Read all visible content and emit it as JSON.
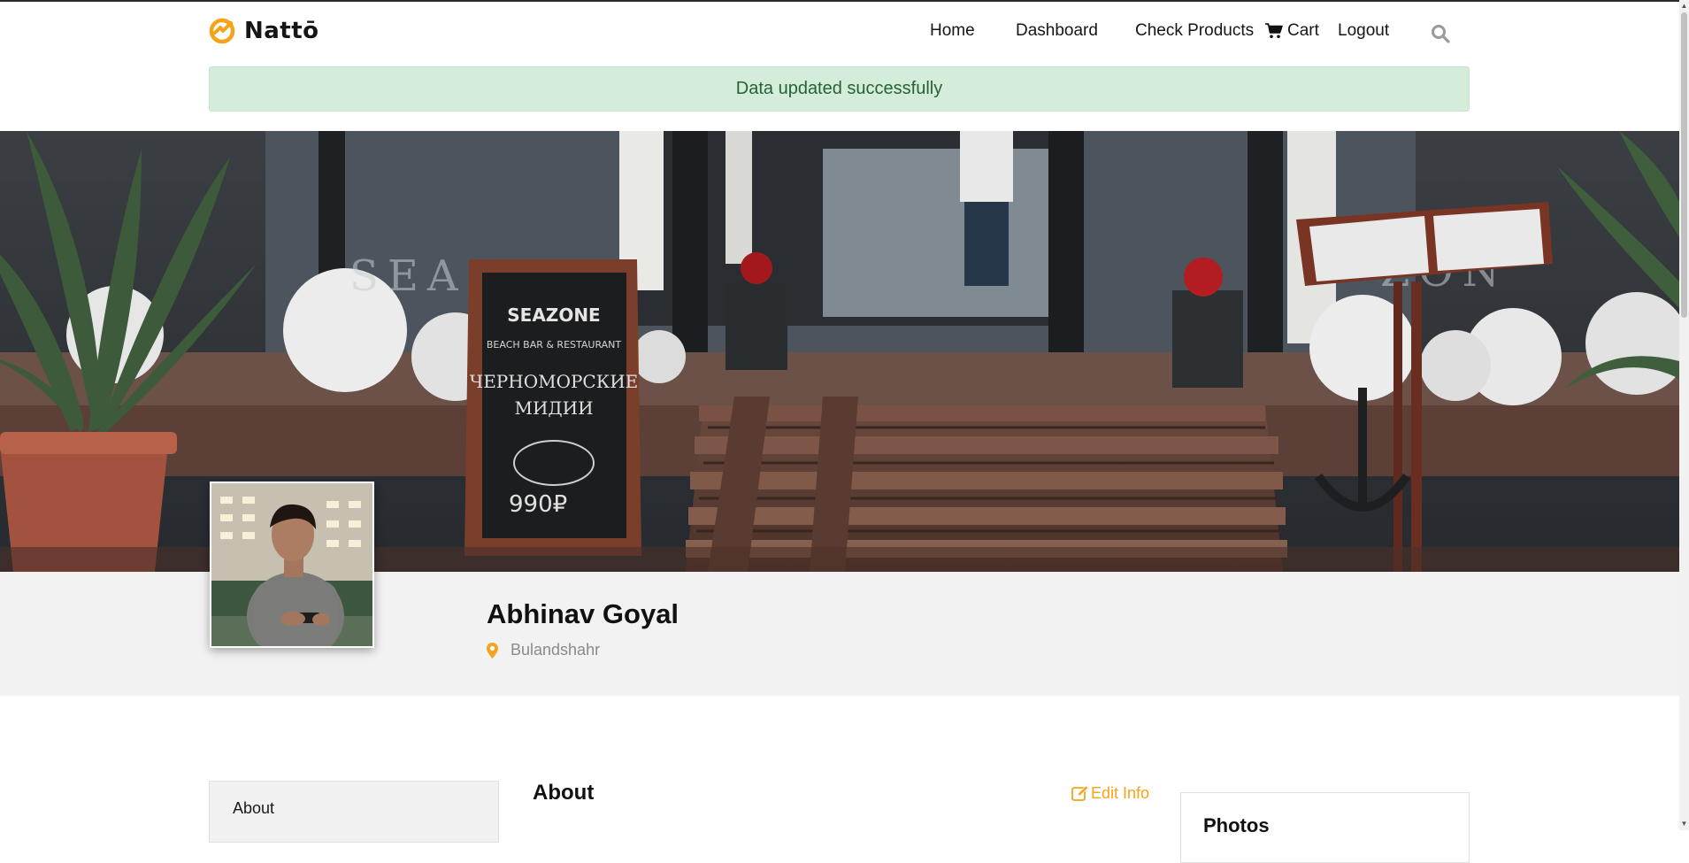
{
  "brand": {
    "name": "Nattō"
  },
  "nav": {
    "items": [
      {
        "label": "Home"
      },
      {
        "label": "Dashboard"
      },
      {
        "label": "Check Products"
      },
      {
        "label": "Cart"
      },
      {
        "label": "Logout"
      }
    ],
    "icons": [
      "cart-icon",
      "search-icon"
    ]
  },
  "alert": {
    "message": "Data updated successfully"
  },
  "profile": {
    "name": "Abhinav Goyal",
    "location": "Bulandshahr",
    "location_icon": "map-marker-icon"
  },
  "sidebar": {
    "items": [
      {
        "label": "About"
      }
    ]
  },
  "main": {
    "section_title": "About",
    "edit_label": "Edit Info",
    "edit_icon": "edit-icon"
  },
  "photos": {
    "title": "Photos"
  },
  "colors": {
    "accent": "#f5a31a",
    "alert_bg": "#d4edda",
    "alert_text": "#276135",
    "band_bg": "#f2f2f2"
  }
}
